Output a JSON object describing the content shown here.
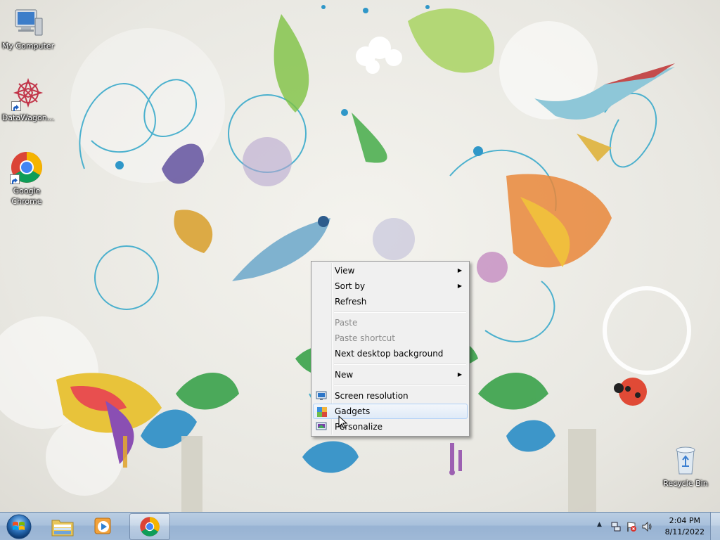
{
  "desktop": {
    "icons": [
      {
        "label": "My Computer",
        "icon": "computer-icon"
      },
      {
        "label": "DataWagon...",
        "icon": "datawagon-icon"
      },
      {
        "label": "Google Chrome",
        "icon": "chrome-icon"
      },
      {
        "label": "Recycle Bin",
        "icon": "recycle-bin-icon"
      }
    ]
  },
  "context_menu": {
    "items": [
      {
        "label": "View",
        "submenu": true,
        "enabled": true
      },
      {
        "label": "Sort by",
        "submenu": true,
        "enabled": true
      },
      {
        "label": "Refresh",
        "enabled": true
      },
      {
        "label": "Paste",
        "enabled": false
      },
      {
        "label": "Paste shortcut",
        "enabled": false
      },
      {
        "label": "Next desktop background",
        "enabled": true
      },
      {
        "label": "New",
        "submenu": true,
        "enabled": true
      },
      {
        "label": "Screen resolution",
        "icon": "monitor-icon",
        "enabled": true
      },
      {
        "label": "Gadgets",
        "icon": "gadgets-icon",
        "enabled": true,
        "highlighted": true
      },
      {
        "label": "Personalize",
        "icon": "personalize-icon",
        "enabled": true
      }
    ],
    "submenu_arrow": "▶"
  },
  "taskbar": {
    "pinned": [
      {
        "icon": "windows-explorer-icon"
      },
      {
        "icon": "media-player-icon"
      },
      {
        "icon": "chrome-icon",
        "active": true
      }
    ],
    "tray": {
      "show_hidden_arrow": "▲",
      "icons": [
        "network-icon",
        "action-center-flag-icon",
        "volume-icon"
      ]
    },
    "clock": {
      "time": "2:04 PM",
      "date": "8/11/2022"
    }
  },
  "colors": {
    "taskbar": "#a9c1dc",
    "menu_bg": "#f0f0f0",
    "menu_highlight_border": "#aecff7",
    "disabled_text": "#8d8d8d"
  }
}
